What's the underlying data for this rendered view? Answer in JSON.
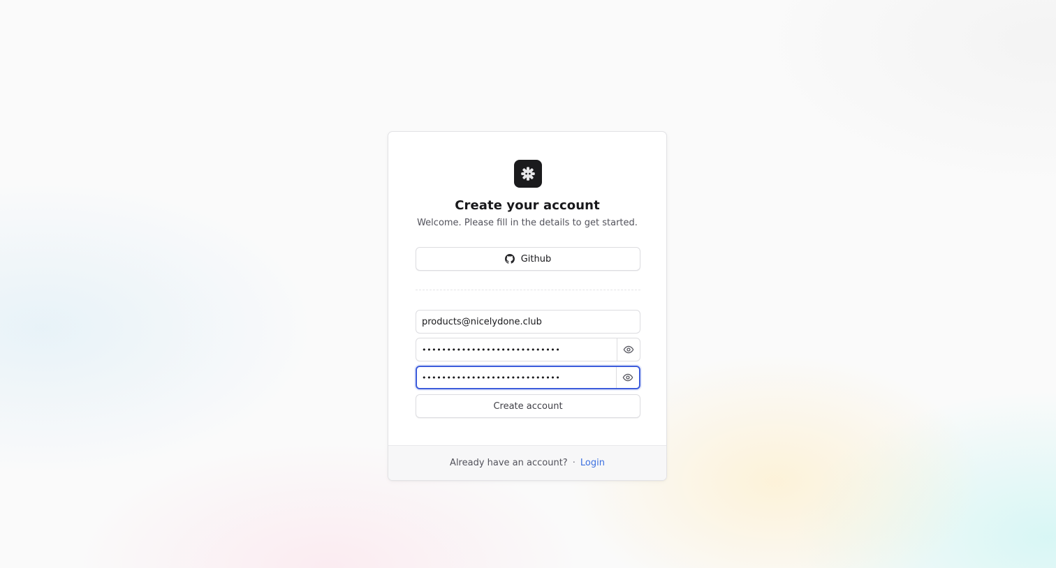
{
  "header": {
    "logo_icon": "gear-icon",
    "title": "Create your account",
    "subtitle": "Welcome. Please fill in the details to get started."
  },
  "oauth": {
    "github_label": "Github",
    "github_icon": "github-icon"
  },
  "form": {
    "email_value": "products@nicelydone.club",
    "password_value": "••••••••••••••••••••••••••••",
    "confirm_password_value": "••••••••••••••••••••••••••••",
    "toggle_icon": "eye-icon",
    "submit_label": "Create account"
  },
  "footer": {
    "prompt": "Already have an account?",
    "separator": "·",
    "login_label": "Login"
  },
  "colors": {
    "accent": "#3b5bdb",
    "link": "#3b6fe0",
    "logo_bg": "#1b1b1d"
  }
}
